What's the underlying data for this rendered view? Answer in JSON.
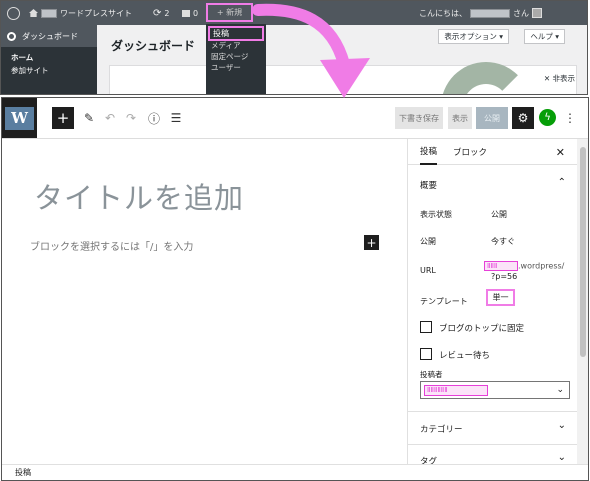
{
  "admin_bar": {
    "site_name": "ワードプレスサイト",
    "comments_count": "2",
    "comment_bubble_count": "0",
    "new_label": "+ 新規",
    "greeting": "こんにちは、",
    "greeting_suffix": "さん"
  },
  "new_menu": {
    "items": [
      "投稿",
      "メディア",
      "固定ページ",
      "ユーザー"
    ]
  },
  "admin_sidebar": {
    "dashboard": "ダッシュボード",
    "home": "ホーム",
    "participating_sites": "参加サイト"
  },
  "admin_main": {
    "title": "ダッシュボード",
    "screen_options": "表示オプション ▾",
    "help": "ヘルプ ▾",
    "dismiss": "✕ 非表示"
  },
  "toolbar": {
    "logo_letter": "W",
    "add_block": "+",
    "save_draft": "下書き保存",
    "preview": "表示",
    "publish": "公開"
  },
  "canvas": {
    "title_placeholder": "タイトルを追加",
    "block_placeholder": "ブロックを選択するには「/」を入力",
    "inline_add": "+"
  },
  "sidebar": {
    "tab_post": "投稿",
    "tab_block": "ブロック",
    "close": "✕",
    "summary": {
      "header": "概要",
      "visibility_label": "表示状態",
      "visibility_value": "公開",
      "publish_label": "公開",
      "publish_value": "今すぐ",
      "url_label": "URL",
      "url_line1": ".wordpress/",
      "url_line2": "?p=56",
      "template_label": "テンプレート",
      "template_value": "単一",
      "sticky_label": "ブログのトップに固定",
      "pending_label": "レビュー待ち",
      "author_label": "投稿者"
    },
    "categories": "カテゴリー",
    "tags": "タグ"
  },
  "footer": {
    "breadcrumb": "投稿"
  },
  "colors": {
    "highlight": "#f07ce6",
    "admin_bar": "#50575e",
    "admin_sidebar": "#2c3338",
    "editor_dark": "#1e1e1e",
    "jetpack_green": "#069e08"
  }
}
